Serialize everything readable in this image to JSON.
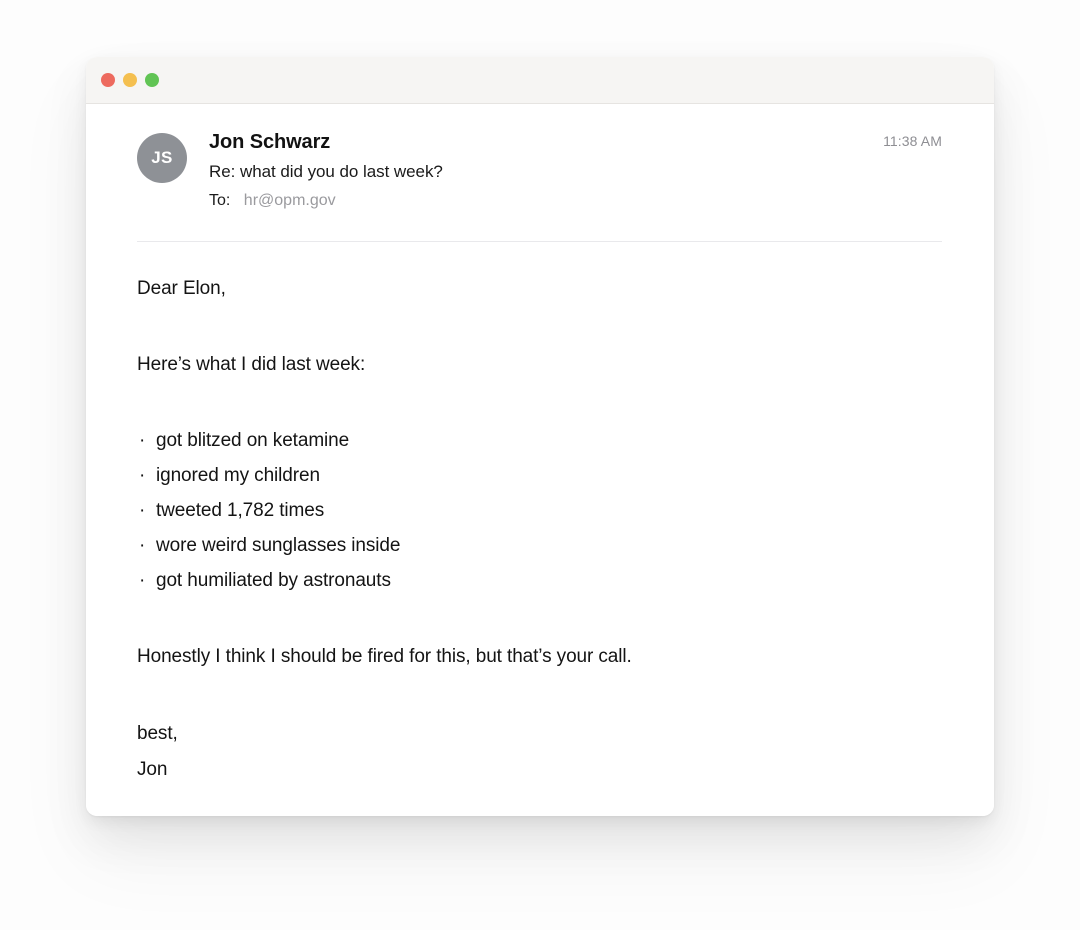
{
  "window": {
    "traffic_lights": [
      {
        "name": "close",
        "color": "#ed6a5e"
      },
      {
        "name": "minimize",
        "color": "#f4bf4f"
      },
      {
        "name": "zoom",
        "color": "#61c454"
      }
    ]
  },
  "message": {
    "avatar_initials": "JS",
    "sender": "Jon Schwarz",
    "subject": "Re: what did you do last week?",
    "to_label": "To:",
    "to_value": "hr@opm.gov",
    "timestamp": "11:38 AM"
  },
  "body": {
    "greeting": "Dear Elon,",
    "intro": "Here’s what I did last week:",
    "bullet_marker": "·",
    "bullets": [
      "got blitzed on ketamine",
      "ignored my children",
      "tweeted 1,782 times",
      "wore weird sunglasses inside",
      "got humiliated by astronauts"
    ],
    "closing": "Honestly I think I should be fired for this, but that’s your call.",
    "signoff": "best,",
    "signature": "Jon"
  }
}
